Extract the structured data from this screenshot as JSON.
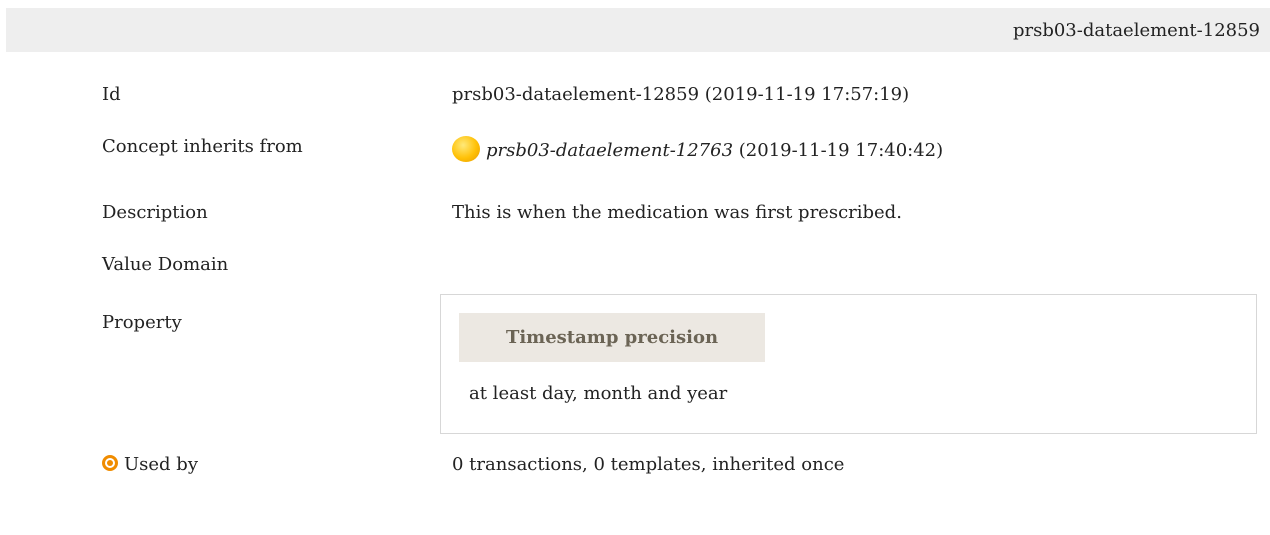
{
  "header": {
    "title": "prsb03-dataelement-12859"
  },
  "rows": {
    "id": {
      "label": "Id",
      "value": "prsb03-dataelement-12859 (2019-11-19 17:57:19)"
    },
    "inherits": {
      "label": "Concept inherits from",
      "link": "prsb03-dataelement-12763",
      "date": " (2019-11-19 17:40:42)",
      "icon": "status-dot-icon"
    },
    "description": {
      "label": "Description",
      "value": "This is when the medication was first prescribed."
    },
    "value_domain": {
      "label": "Value Domain"
    },
    "property": {
      "label": "Property",
      "heading": "Timestamp precision",
      "value": "at least day, month and year"
    },
    "used_by": {
      "label": "Used by",
      "value": "0 transactions, 0 templates, inherited once",
      "icon": "target-icon"
    }
  },
  "colors": {
    "accent": "#f08c00",
    "header_bg": "#eeeeee",
    "property_head_bg": "#ece8e2"
  }
}
